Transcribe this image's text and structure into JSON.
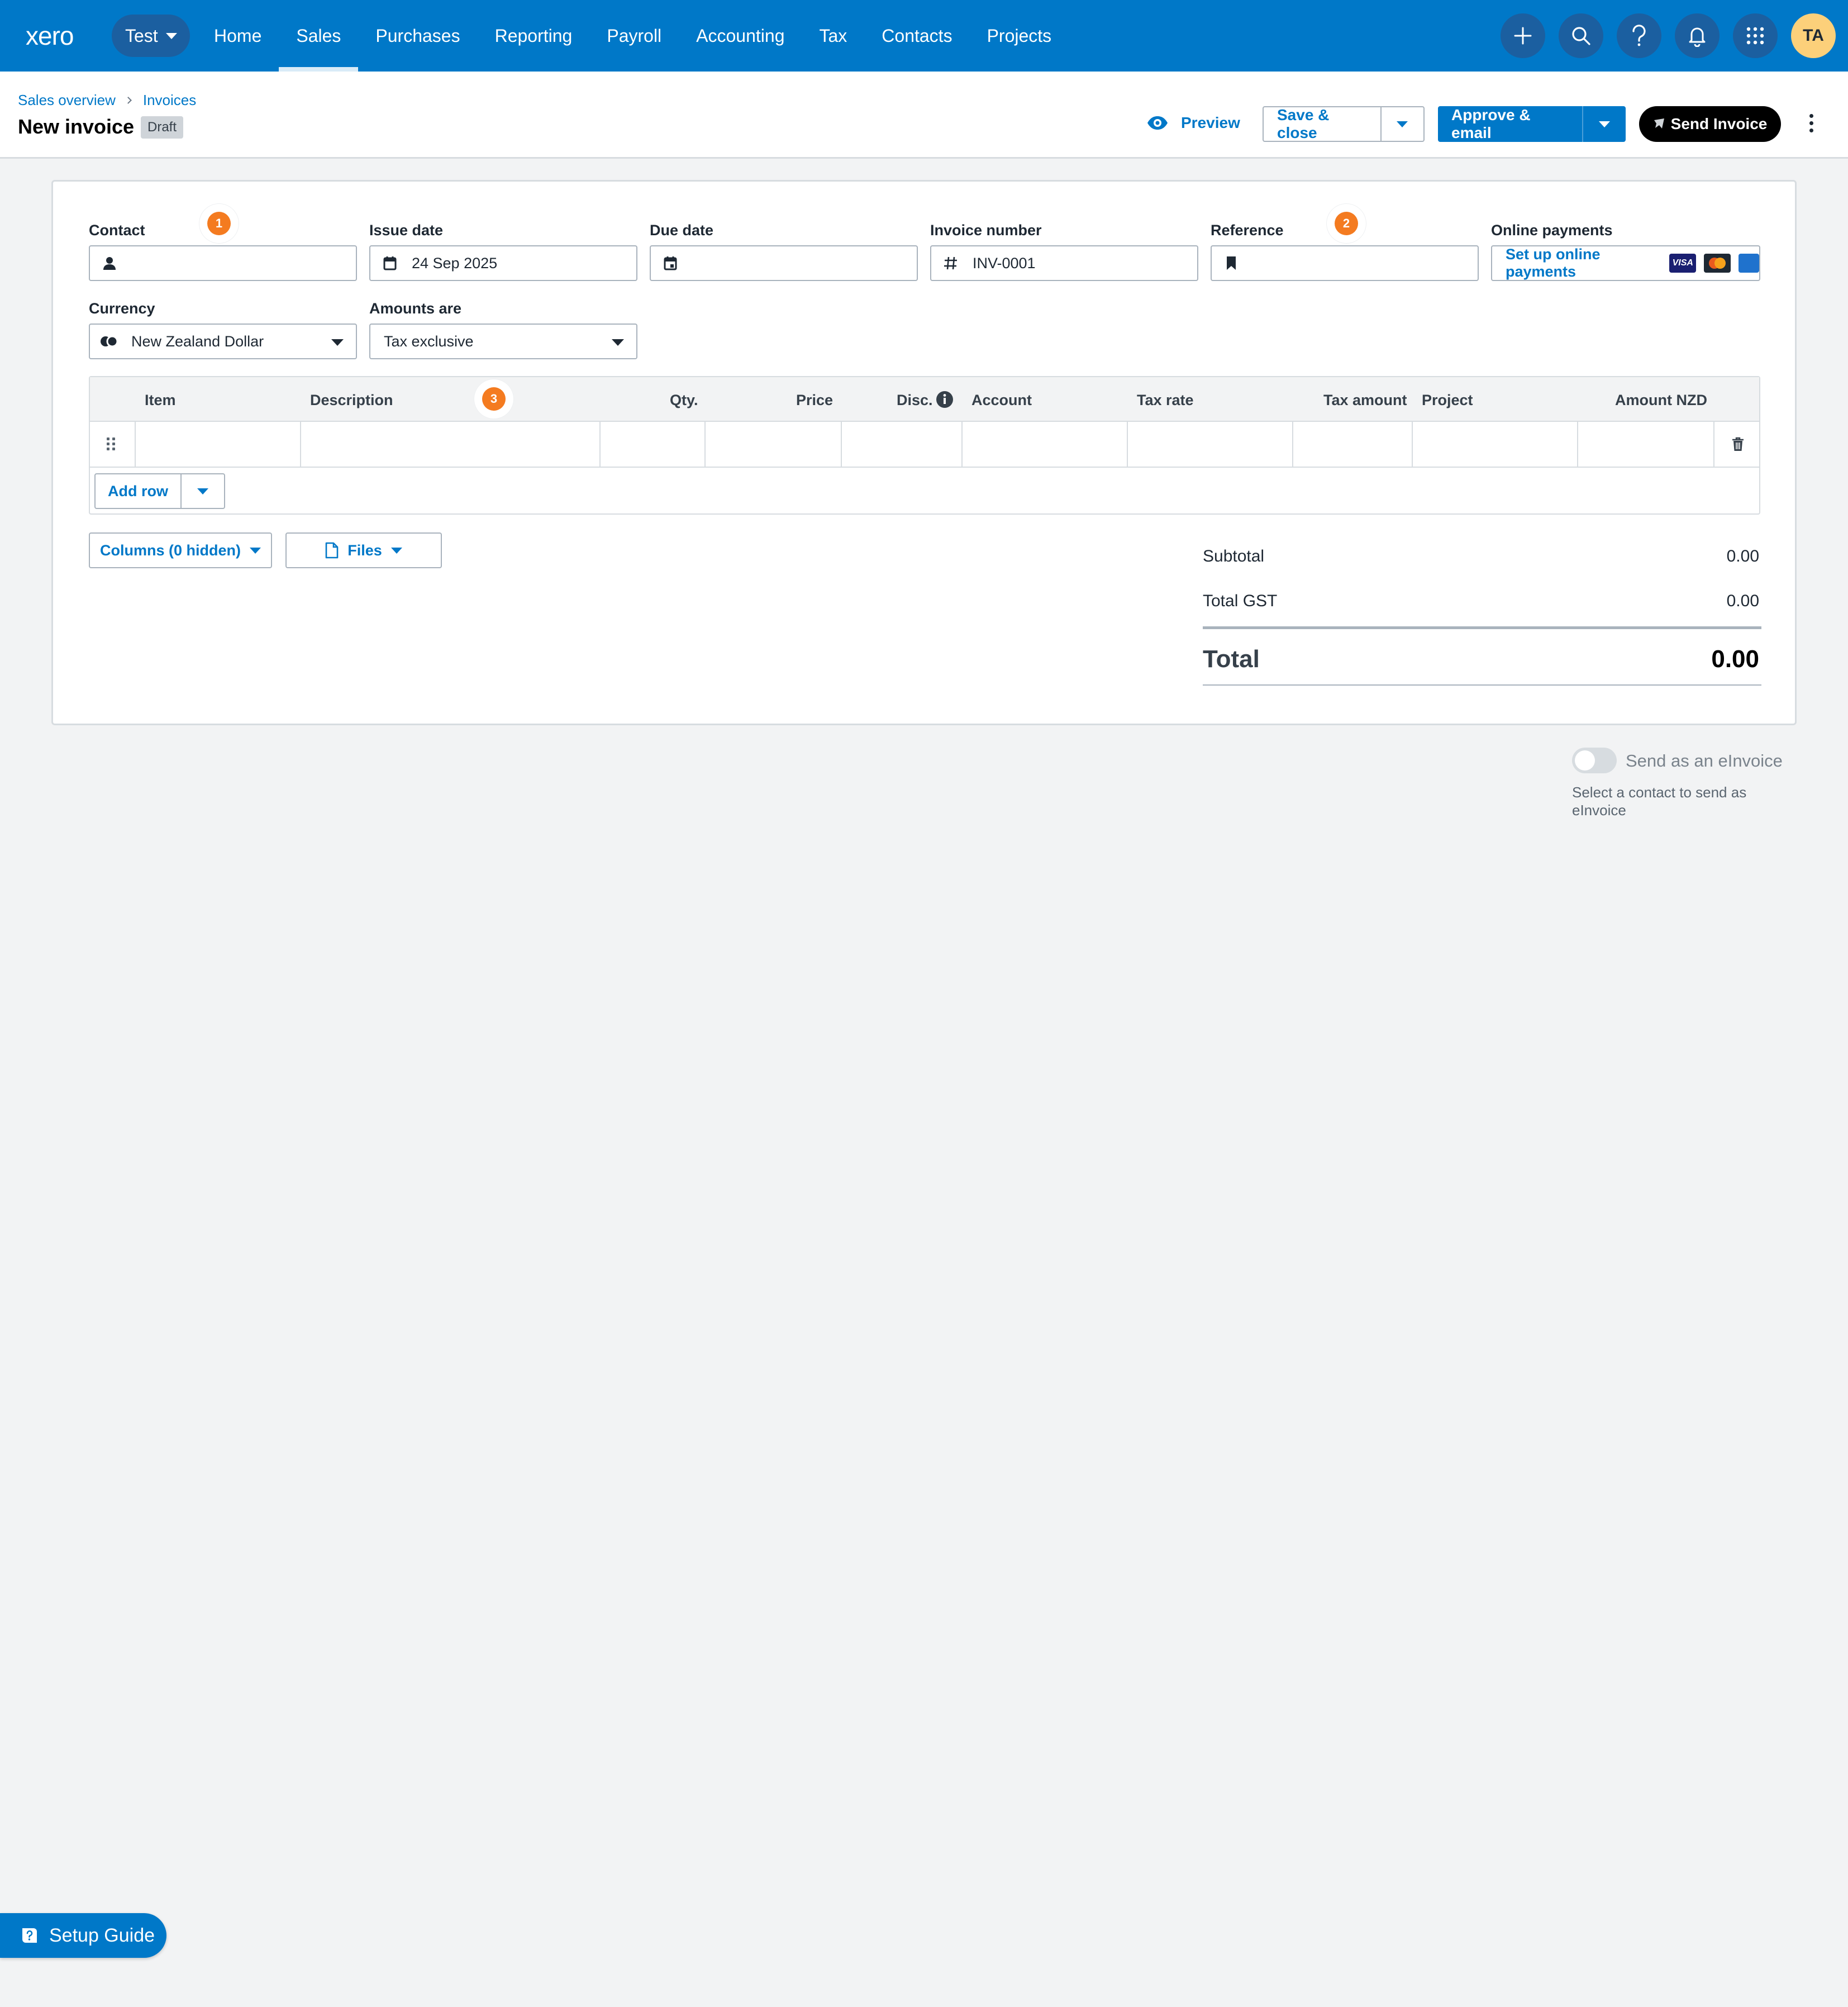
{
  "nav": {
    "logo": "xero",
    "org": "Test",
    "links": [
      "Home",
      "Sales",
      "Purchases",
      "Reporting",
      "Payroll",
      "Accounting",
      "Tax",
      "Contacts",
      "Projects"
    ],
    "active": "Sales",
    "icons": [
      "plus-icon",
      "search-icon",
      "help-icon",
      "bell-icon",
      "apps-grid-icon"
    ],
    "avatar_initials": "TA",
    "colors": {
      "brand": "#0078c8",
      "avatar": "#fcd07a"
    }
  },
  "header": {
    "breadcrumb": [
      "Sales overview",
      "Invoices"
    ],
    "title": "New invoice",
    "status": "Draft",
    "preview": "Preview",
    "save_close": "Save & close",
    "approve_email": "Approve & email",
    "send_invoice": "Send Invoice"
  },
  "form": {
    "contact_label": "Contact",
    "contact_value": "",
    "issue_date_label": "Issue date",
    "issue_date_value": "24 Sep 2025",
    "due_date_label": "Due date",
    "due_date_value": "",
    "invoice_number_label": "Invoice number",
    "invoice_number_value": "INV-0001",
    "reference_label": "Reference",
    "reference_value": "",
    "online_payments_label": "Online payments",
    "online_payments_link": "Set up online payments",
    "payment_cards": [
      "VISA",
      "mastercard",
      "amex"
    ],
    "currency_label": "Currency",
    "currency_value": "New Zealand Dollar",
    "amounts_are_label": "Amounts are",
    "amounts_are_value": "Tax exclusive",
    "step_badges": [
      "1",
      "2",
      "3"
    ],
    "step_color": "#f47b20"
  },
  "items": {
    "columns": [
      "Item",
      "Description",
      "Qty.",
      "Price",
      "Disc.",
      "Account",
      "Tax rate",
      "Tax amount",
      "Project",
      "Amount NZD"
    ],
    "rows": [
      [
        "",
        "",
        "",
        "",
        "",
        "",
        "",
        "",
        "",
        ""
      ]
    ],
    "add_row": "Add row",
    "columns_button": "Columns (0 hidden)",
    "files_button": "Files"
  },
  "totals": {
    "subtotal_label": "Subtotal",
    "subtotal": "0.00",
    "gst_label": "Total GST",
    "gst": "0.00",
    "total_label": "Total",
    "total": "0.00"
  },
  "einvoice": {
    "toggle_label": "Send as an eInvoice",
    "toggle_on": false,
    "hint": "Select a contact to send as eInvoice"
  },
  "setup_guide": "Setup Guide"
}
